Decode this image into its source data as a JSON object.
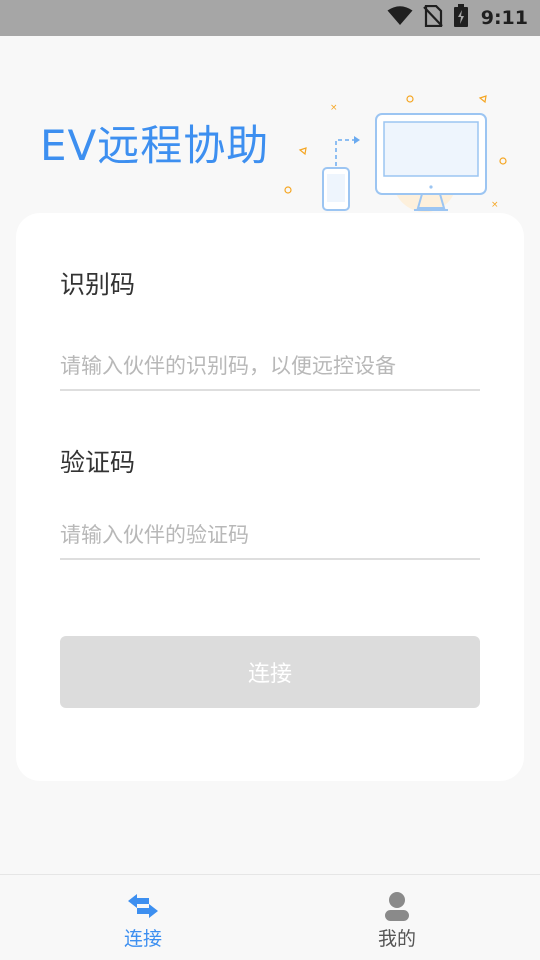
{
  "status_bar": {
    "time": "9:11",
    "icons": [
      "wifi-icon",
      "no-sim-icon",
      "battery-charging-icon"
    ]
  },
  "header": {
    "title": "EV远程协助"
  },
  "form": {
    "id_code": {
      "label": "识别码",
      "placeholder": "请输入伙伴的识别码，以便远控设备",
      "value": ""
    },
    "verify_code": {
      "label": "验证码",
      "placeholder": "请输入伙伴的验证码",
      "value": ""
    },
    "connect_label": "连接"
  },
  "bottom_nav": {
    "items": [
      {
        "label": "连接",
        "icon": "swap-arrows-icon",
        "active": true,
        "color": "#3d8ff0"
      },
      {
        "label": "我的",
        "icon": "person-icon",
        "active": false,
        "color": "#555555"
      }
    ]
  },
  "colors": {
    "accent": "#3d8ff0",
    "button_disabled": "#dcdcdc",
    "status_bar": "#a6a6a6",
    "background": "#f8f8f8",
    "illustration_orange": "#f5a623"
  }
}
